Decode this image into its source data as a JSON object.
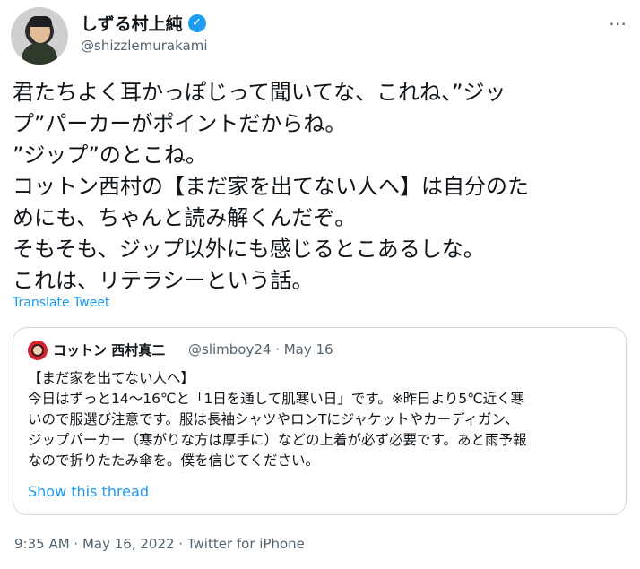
{
  "tweet": {
    "display_name": "しずる村上純",
    "handle": "@shizzlemurakami",
    "more_icon": "⋯",
    "verified_icon": "✓",
    "text": "君たちよく耳かっぽじって聞いてな、これね、”ジッ\nプ”パーカーがポイントだからね。\n”ジップ”のとこね。\nコットン西村の【まだ家を出てない人へ】は自分のた\nめにも、ちゃんと読み解くんだぞ。\nそもそも、ジップ以外にも感じるとこあるしな。\nこれは、リテラシーという話。",
    "translate_label": "Translate Tweet",
    "timestamp": "9:35 AM · May 16, 2022 · Twitter for iPhone"
  },
  "quote": {
    "name": "コットン 西村真二",
    "handle_date": "@slimboy24 · May 16",
    "text": "【まだ家を出てない人へ】\n今日はずっと14～16℃と「1日を通して肌寒い日」です。※昨日より5℃近く寒\nいので服選び注意です。服は長袖シャツやロンTにジャケットやカーディガン、\nジップパーカー（寒がりな方は厚手に）などの上着が必ず必要です。あと雨予報\nなので折りたたみ傘を。僕を信じてください。",
    "show_thread_label": "Show this thread"
  },
  "colors": {
    "accent": "#1d9bf0",
    "secondary_text": "#536471",
    "border": "#cfd9de"
  }
}
